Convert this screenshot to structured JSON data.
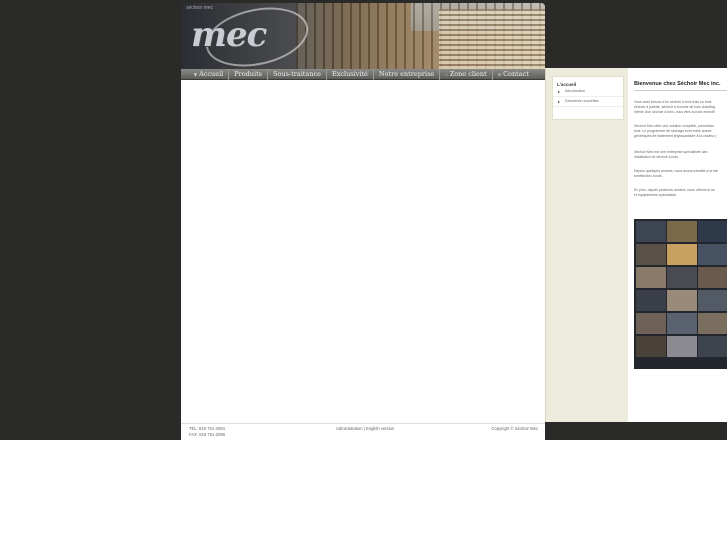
{
  "header": {
    "logo": "mec",
    "logo_small": "séchoir mec"
  },
  "nav": [
    {
      "label": "Accueil"
    },
    {
      "label": "Produits"
    },
    {
      "label": "Sous-traitance"
    },
    {
      "label": "Exclusivité"
    },
    {
      "label": "Notre entreprise"
    },
    {
      "label": "Zone client"
    },
    {
      "label": "Contact"
    }
  ],
  "footer": {
    "tel": "TEL: 819 751-2084",
    "fax": "FAX: 819 751-2096",
    "links": "Administration | English version",
    "copyright": "Copyright © Séchoir Mec"
  },
  "embed": {
    "sidebar": {
      "title": "L'accueil",
      "links": [
        "Introduction",
        "Dernières nouvelles"
      ]
    },
    "heading": "Bienvenue chez Séchoir Mec inc.",
    "paragraphs": [
      "Vous avez besoin d'un séchoir à bois frais ou bois",
      "séchoir à palette, séchoir à fourche de bois chauffag",
      "même d'un séchoir à bois, vous êtes au bon endroit!",
      "Séchoir Mec offre une solution complète, permettan",
      "bois. Le programme de séchage écrit entre autres",
      "génériques de traitement phytosanitaire à la chaleur (",
      "Séchoir Mec est une entreprise spécialisée dan",
      "installation de séchoir à bois.",
      "Depuis quelques années, nous avons travaillé à la fab",
      "torréfaction à bois.",
      "En plus, depuis plusieurs années, nous offrons le se",
      "et équipements spécialisés."
    ]
  }
}
